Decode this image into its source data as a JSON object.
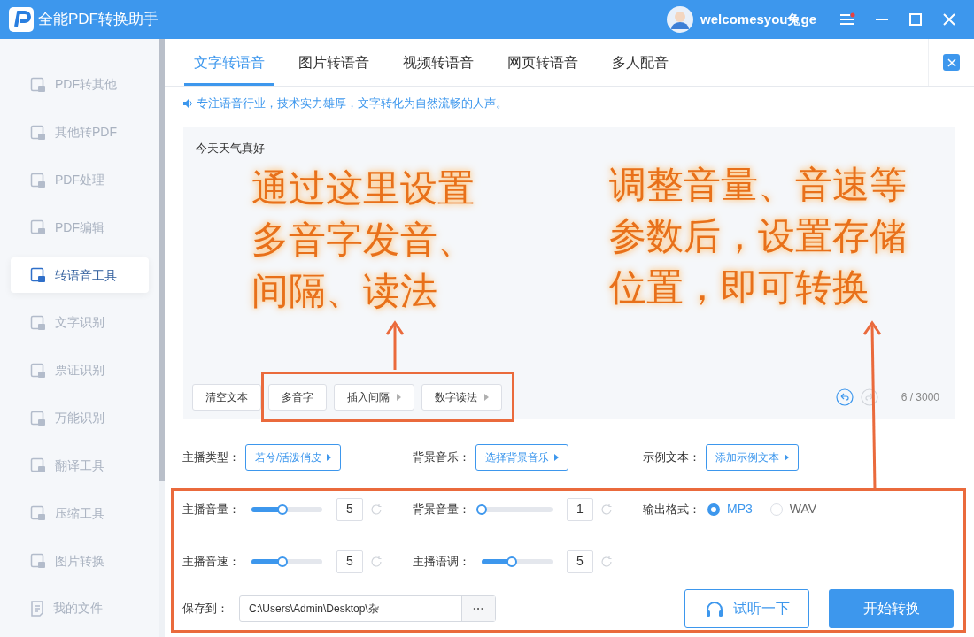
{
  "window": {
    "title": "全能PDF转换助手",
    "user": "welcomesyou兔ge"
  },
  "sidebar": {
    "items": [
      {
        "label": "PDF转其他",
        "selected": false
      },
      {
        "label": "其他转PDF",
        "selected": false
      },
      {
        "label": "PDF处理",
        "selected": false
      },
      {
        "label": "PDF编辑",
        "selected": false
      },
      {
        "label": "转语音工具",
        "selected": true
      },
      {
        "label": "文字识别",
        "selected": false
      },
      {
        "label": "票证识别",
        "selected": false
      },
      {
        "label": "万能识别",
        "selected": false
      },
      {
        "label": "翻译工具",
        "selected": false
      },
      {
        "label": "压缩工具",
        "selected": false
      },
      {
        "label": "图片转换",
        "selected": false
      }
    ],
    "footer_item": "我的文件"
  },
  "tabs": [
    {
      "label": "文字转语音",
      "selected": true
    },
    {
      "label": "图片转语音",
      "selected": false
    },
    {
      "label": "视频转语音",
      "selected": false
    },
    {
      "label": "网页转语音",
      "selected": false
    },
    {
      "label": "多人配音",
      "selected": false
    }
  ],
  "notice": "专注语音行业，技术实力雄厚，文字转化为自然流畅的人声。",
  "editor": {
    "value": "今天天气真好",
    "buttons": [
      {
        "label": "清空文本",
        "dropdown": false
      },
      {
        "label": "多音字",
        "dropdown": false
      },
      {
        "label": "插入间隔",
        "dropdown": true
      },
      {
        "label": "数字读法",
        "dropdown": true
      }
    ],
    "undo": {
      "disabled": false
    },
    "redo": {
      "disabled": true
    },
    "count": "6 / 3000"
  },
  "options": [
    {
      "label": "主播类型：",
      "value": "若兮/活泼俏皮"
    },
    {
      "label": "背景音乐：",
      "value": "选择背景音乐"
    },
    {
      "label": "示例文本：",
      "value": "添加示例文本"
    }
  ],
  "sliders": [
    {
      "label": "主播音量：",
      "level": 0.44,
      "value": "5"
    },
    {
      "label": "背景音量：",
      "level": 0,
      "value": "1"
    },
    {
      "label": "主播音速：",
      "level": 0.44,
      "value": "5"
    },
    {
      "label": "主播语调：",
      "level": 0.43,
      "value": "5"
    }
  ],
  "output_format": {
    "label": "输出格式：",
    "choices": [
      {
        "label": "MP3",
        "selected": true
      },
      {
        "label": "WAV",
        "selected": false
      }
    ]
  },
  "save": {
    "label": "保存到：",
    "path": "C:\\Users\\Admin\\Desktop\\杂",
    "browse": "···"
  },
  "actions": {
    "preview": "试听一下",
    "start": "开始转换"
  },
  "annotations": [
    {
      "lines": [
        "通过这里设置",
        "多音字发音、",
        "间隔、读法"
      ]
    },
    {
      "lines": [
        "调整音量、音速等",
        "参数后，设置存储",
        "位置，即可转换"
      ]
    }
  ]
}
